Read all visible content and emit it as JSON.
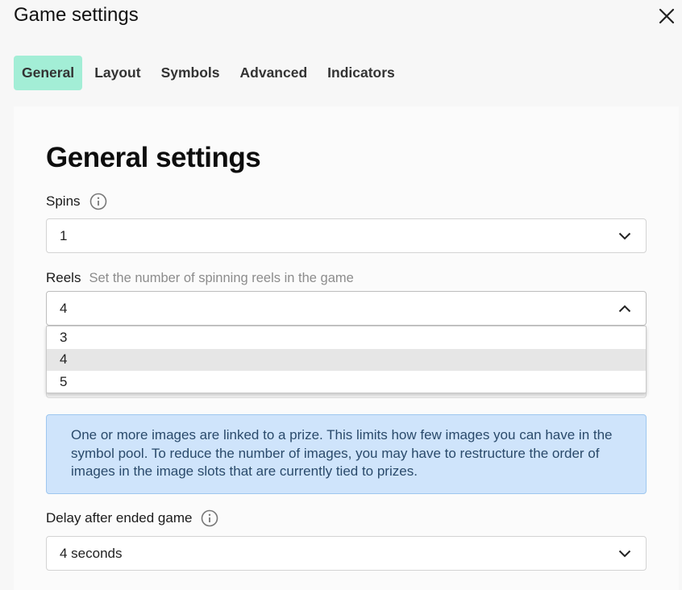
{
  "dialog": {
    "title": "Game settings"
  },
  "tabs": [
    {
      "label": "General",
      "active": true
    },
    {
      "label": "Layout"
    },
    {
      "label": "Symbols"
    },
    {
      "label": "Advanced"
    },
    {
      "label": "Indicators"
    }
  ],
  "general": {
    "heading": "General settings",
    "spins": {
      "label": "Spins",
      "value": "1"
    },
    "reels": {
      "label": "Reels",
      "hint": "Set the number of spinning reels in the game",
      "value": "4",
      "options": [
        "3",
        "4",
        "5"
      ],
      "selected_option": "4"
    },
    "notice": "One or more images are linked to a prize. This limits how few images you can have in the symbol pool. To reduce the number of images, you may have to restructure the order of images in the image slots that are currently tied to prizes.",
    "delay": {
      "label": "Delay after ended game",
      "value": "4 seconds"
    }
  },
  "colors": {
    "active_tab": "#a3eed6",
    "notice_bg": "#cfe4fb",
    "notice_border": "#9ec7ef",
    "notice_text": "#2a4a6b"
  }
}
